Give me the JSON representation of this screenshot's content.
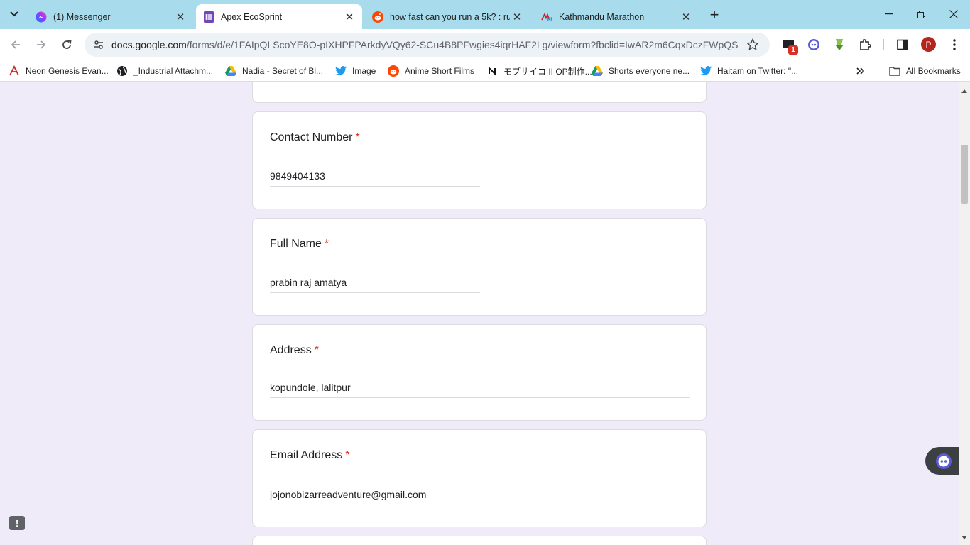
{
  "browser": {
    "tabs": [
      {
        "title": "(1) Messenger",
        "icon": "messenger-icon"
      },
      {
        "title": "Apex EcoSprint",
        "icon": "google-forms-icon",
        "active": true
      },
      {
        "title": "how fast can you run a 5k? : run",
        "icon": "reddit-icon"
      },
      {
        "title": "Kathmandu Marathon",
        "icon": "km-icon"
      }
    ],
    "url_host": "docs.google.com",
    "url_path": "/forms/d/e/1FAIpQLScoYE8O-pIXHPFPArkdyVQy62-SCu4B8PFwgies4iqrHAF2Lg/viewform?fbclid=IwAR2m6CqxDczFWpQSsQ...",
    "extension_badge": "1",
    "profile_initial": "P",
    "bookmarks": [
      {
        "label": "Neon Genesis Evan...",
        "icon": "eva-icon"
      },
      {
        "label": "_Industrial Attachm...",
        "icon": "globe-icon"
      },
      {
        "label": "Nadia - Secret of Bl...",
        "icon": "google-drive-icon"
      },
      {
        "label": "Image",
        "icon": "twitter-icon"
      },
      {
        "label": "Anime Short Films",
        "icon": "reddit-icon"
      },
      {
        "label": "モブサイコ II OP制作...",
        "icon": "notion-icon"
      },
      {
        "label": "Shorts everyone ne...",
        "icon": "google-drive-icon"
      },
      {
        "label": "Haitam on Twitter: \"...",
        "icon": "twitter-icon"
      }
    ],
    "all_bookmarks": "All Bookmarks"
  },
  "form": {
    "questions": [
      {
        "title": "Contact Number",
        "required": "*",
        "answer": "9849404133"
      },
      {
        "title": "Full Name",
        "required": "*",
        "answer": "prabin raj amatya"
      },
      {
        "title": "Address",
        "required": "*",
        "answer": "kopundole, lalitpur"
      },
      {
        "title": "Email Address",
        "required": "*",
        "answer": "jojonobizarreadventure@gmail.com"
      }
    ]
  },
  "colors": {
    "tabstrip": "#a8dced",
    "page_background": "#f0ebf8",
    "required_asterisk": "#d93025"
  }
}
